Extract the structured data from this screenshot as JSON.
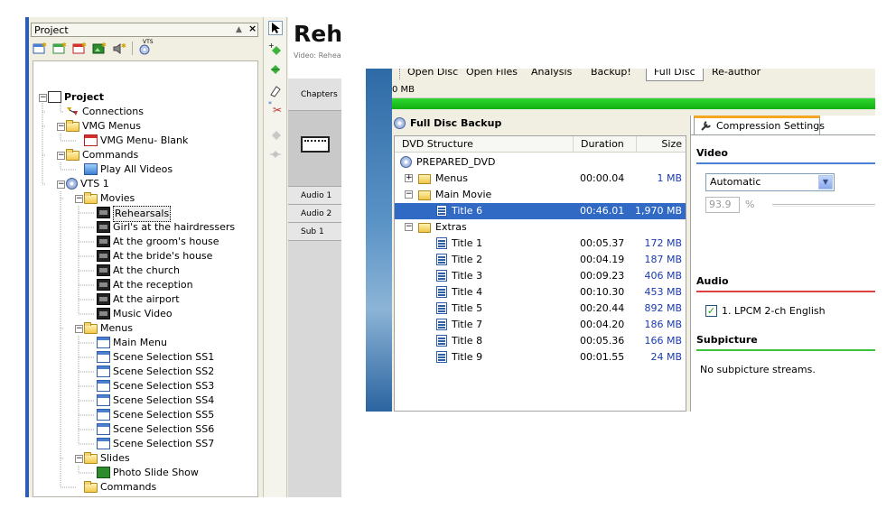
{
  "left": {
    "panel_title": "Project",
    "pin_glyph": "▲",
    "close_glyph": "×",
    "vts_tool_label": "VTS",
    "tree": [
      {
        "label": "Project",
        "icon": "project-icon",
        "bold": true
      },
      {
        "label": "Connections",
        "icon": "connections-icon"
      },
      {
        "label": "VMG Menus",
        "icon": "folder-icon"
      },
      {
        "label": "VMG Menu- Blank",
        "icon": "menu-red-icon"
      },
      {
        "label": "Commands",
        "icon": "folder-icon"
      },
      {
        "label": "Play All Videos",
        "icon": "command-icon"
      },
      {
        "label": "VTS 1",
        "icon": "disc-icon"
      },
      {
        "label": "Movies",
        "icon": "folder-icon"
      },
      {
        "label": "Rehearsals",
        "icon": "film-icon",
        "selected": true
      },
      {
        "label": "Girl's at the hairdressers",
        "icon": "film-icon"
      },
      {
        "label": "At the groom's house",
        "icon": "film-icon"
      },
      {
        "label": "At the bride's house",
        "icon": "film-icon"
      },
      {
        "label": "At the church",
        "icon": "film-icon"
      },
      {
        "label": "At the reception",
        "icon": "film-icon"
      },
      {
        "label": "At the airport",
        "icon": "film-icon"
      },
      {
        "label": "Music Video",
        "icon": "film-icon"
      },
      {
        "label": "Menus",
        "icon": "folder-icon"
      },
      {
        "label": "Main Menu",
        "icon": "menu-icon"
      },
      {
        "label": "Scene Selection SS1",
        "icon": "menu-icon"
      },
      {
        "label": "Scene Selection SS2",
        "icon": "menu-icon"
      },
      {
        "label": "Scene Selection SS3",
        "icon": "menu-icon"
      },
      {
        "label": "Scene Selection SS4",
        "icon": "menu-icon"
      },
      {
        "label": "Scene Selection SS5",
        "icon": "menu-icon"
      },
      {
        "label": "Scene Selection SS6",
        "icon": "menu-icon"
      },
      {
        "label": "Scene Selection SS7",
        "icon": "menu-icon"
      },
      {
        "label": "Slides",
        "icon": "folder-icon"
      },
      {
        "label": "Photo Slide Show",
        "icon": "slideshow-icon"
      },
      {
        "label": "Commands",
        "icon": "folder-icon"
      }
    ],
    "editor": {
      "title": "Rehe",
      "subtitle": "Video: Rehea",
      "chapters": "Chapters",
      "audio1": "Audio 1",
      "audio2": "Audio 2",
      "sub1": "Sub 1"
    }
  },
  "right": {
    "toolbar": [
      "Open Disc",
      "Open Files",
      "Analysis",
      "Backup!",
      "Full Disc",
      "Re-author"
    ],
    "size_label": "0 MB",
    "progress_fraction": 1.0,
    "backup_title": "Full Disc Backup",
    "columns": {
      "structure": "DVD Structure",
      "duration": "Duration",
      "size": "Size"
    },
    "rows": [
      {
        "name": "PREPARED_DVD",
        "duration": "",
        "size": "",
        "type": "disc"
      },
      {
        "name": "Menus",
        "duration": "00:00.04",
        "size": "1 MB",
        "type": "folder"
      },
      {
        "name": "Main Movie",
        "duration": "",
        "size": "",
        "type": "folder"
      },
      {
        "name": "Title 6",
        "duration": "00:46.01",
        "size": "1,970 MB",
        "type": "title",
        "selected": true
      },
      {
        "name": "Extras",
        "duration": "",
        "size": "",
        "type": "folder"
      },
      {
        "name": "Title 1",
        "duration": "00:05.37",
        "size": "172 MB",
        "type": "title"
      },
      {
        "name": "Title 2",
        "duration": "00:04.19",
        "size": "187 MB",
        "type": "title"
      },
      {
        "name": "Title 3",
        "duration": "00:09.23",
        "size": "406 MB",
        "type": "title"
      },
      {
        "name": "Title 4",
        "duration": "00:10.30",
        "size": "453 MB",
        "type": "title"
      },
      {
        "name": "Title 5",
        "duration": "00:20.44",
        "size": "892 MB",
        "type": "title"
      },
      {
        "name": "Title 7",
        "duration": "00:04.20",
        "size": "186 MB",
        "type": "title"
      },
      {
        "name": "Title 8",
        "duration": "00:05.36",
        "size": "166 MB",
        "type": "title"
      },
      {
        "name": "Title 9",
        "duration": "00:01.55",
        "size": "24 MB",
        "type": "title"
      }
    ],
    "settings": {
      "tab_label": "Compression Settings",
      "video_header": "Video",
      "video_mode": "Automatic",
      "percent": "93.9",
      "percent_sign": "%",
      "audio_header": "Audio",
      "audio_track": "1. LPCM 2-ch English",
      "audio_checked": true,
      "subpicture_header": "Subpicture",
      "subpicture_text": "No subpicture streams."
    },
    "colors": {
      "selection": "#316ac5",
      "progress": "#1cc41c",
      "video_line": "#4a7fd4",
      "audio_line": "#e04040",
      "subpicture_line": "#3cc43c",
      "tab_accent": "#f5a623"
    }
  }
}
